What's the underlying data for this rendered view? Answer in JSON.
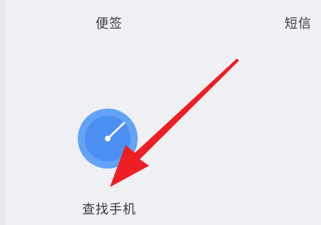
{
  "apps": {
    "notes": {
      "label": "便签",
      "icon": "notes-icon"
    },
    "sms": {
      "label": "短信",
      "icon": "sms-icon"
    },
    "find_phone": {
      "label": "查找手机",
      "icon": "radar-icon"
    }
  },
  "annotation": {
    "type": "arrow",
    "color": "#ec1f24"
  },
  "colors": {
    "background": "#eef0f4",
    "icon_outer": "#62a3f5",
    "icon_inner": "#4b8ff2",
    "icon_glyph": "#ffffff",
    "label_text": "#3a3a3a"
  }
}
